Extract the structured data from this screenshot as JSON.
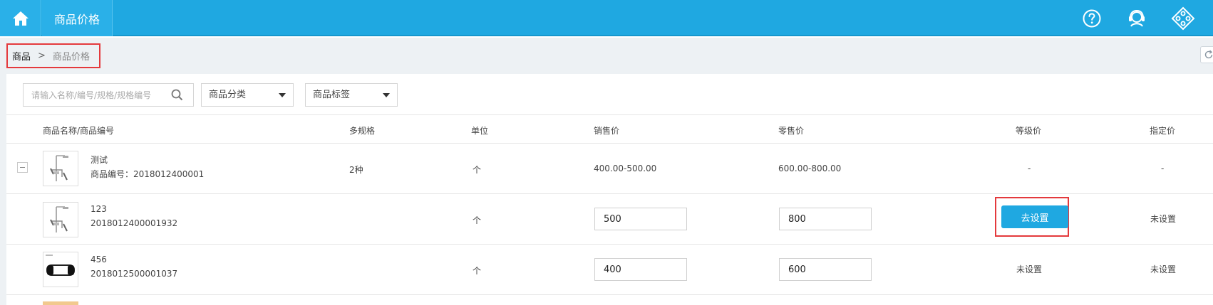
{
  "topbar": {
    "title": "商品价格",
    "icons": [
      "home-icon",
      "help-icon",
      "customer-service-icon",
      "grid-menu-icon"
    ]
  },
  "breadcrumb": {
    "first": "商品",
    "separator": ">",
    "current": "商品价格"
  },
  "filters": {
    "search_placeholder": "请输入名称/编号/规格/规格编号",
    "category_label": "商品分类",
    "tag_label": "商品标签"
  },
  "table": {
    "headers": {
      "name": "商品名称/商品编号",
      "specs": "多规格",
      "unit": "单位",
      "sale_price": "销售价",
      "retail_price": "零售价",
      "level_price": "等级价",
      "designated_price": "指定价"
    },
    "parent_row": {
      "name": "测试",
      "code": "商品编号：2018012400001",
      "specs": "2种",
      "unit": "个",
      "sale_price": "400.00-500.00",
      "retail_price": "600.00-800.00",
      "level_price": "-",
      "designated_price": "-"
    },
    "sku_rows": [
      {
        "name": "123",
        "code": "2018012400001932",
        "unit": "个",
        "sale_price": "500",
        "retail_price": "800",
        "level_price_button": "去设置",
        "designated_price": "未设置"
      },
      {
        "name": "456",
        "code": "2018012500001037",
        "unit": "个",
        "sale_price": "400",
        "retail_price": "600",
        "level_price": "未设置",
        "designated_price": "未设置"
      }
    ]
  },
  "colors": {
    "primary": "#1fa8e1",
    "highlight_border": "#e4393c",
    "breadcrumb_bg": "#edf1f4"
  }
}
